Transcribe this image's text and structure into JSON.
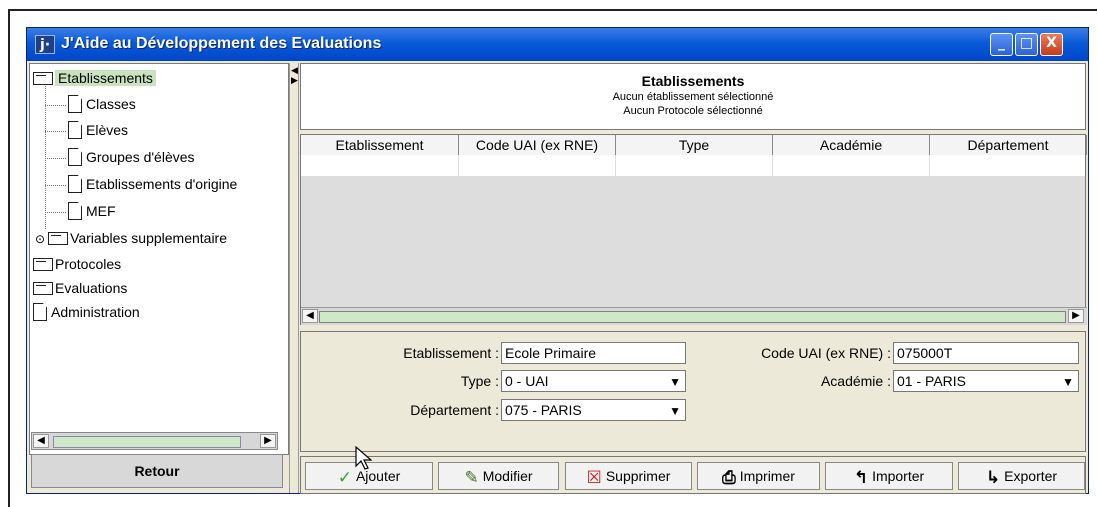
{
  "window": {
    "title": "J'Aide au Développement des Evaluations",
    "icon": "j·",
    "buttons": [
      "_",
      "□",
      "X"
    ]
  },
  "tree": {
    "items": [
      {
        "label": "Etablissements",
        "type": "folder",
        "selected": true
      },
      {
        "label": "Classes",
        "type": "document"
      },
      {
        "label": "Elèves",
        "type": "document"
      },
      {
        "label": "Groupes d'élèves",
        "type": "document"
      },
      {
        "label": "Etablissements d'origine",
        "type": "document"
      },
      {
        "label": "MEF",
        "type": "document"
      },
      {
        "label": "Variables supplementaire",
        "type": "folder",
        "expandable": true
      },
      {
        "label": "Protocoles",
        "type": "folder"
      },
      {
        "label": "Evaluations",
        "type": "folder"
      },
      {
        "label": "Administration",
        "type": "document"
      }
    ]
  },
  "retour": {
    "label": "Retour"
  },
  "header": {
    "title": "Etablissements",
    "subtitle_1": "Aucun établissement sélectionné",
    "subtitle_2": "Aucun Protocole sélectionné"
  },
  "table": {
    "columns": [
      "Etablissement",
      "Code UAI (ex RNE)",
      "Type",
      "Académie",
      "Département"
    ],
    "rows": [
      [
        "",
        "",
        "",
        "",
        ""
      ]
    ]
  },
  "form": {
    "etablissement_label": "Etablissement :",
    "etablissement_value": "Ecole Primaire",
    "code_label": "Code UAI (ex RNE) :",
    "code_value": "075000T",
    "type_label": "Type :",
    "type_value": "0 - UAI",
    "academie_label": "Académie :",
    "academie_value": "01 - PARIS",
    "departement_label": "Département :",
    "departement_value": "075 - PARIS"
  },
  "buttons": {
    "ajouter": "Ajouter",
    "modifier": "Modifier",
    "supprimer": "Supprimer",
    "imprimer": "Imprimer",
    "importer": "Importer",
    "exporter": "Exporter"
  },
  "colors": {
    "titlebar": "#0a5ad8",
    "selection": "#c9e3bf",
    "panel": "#ece9d8"
  }
}
